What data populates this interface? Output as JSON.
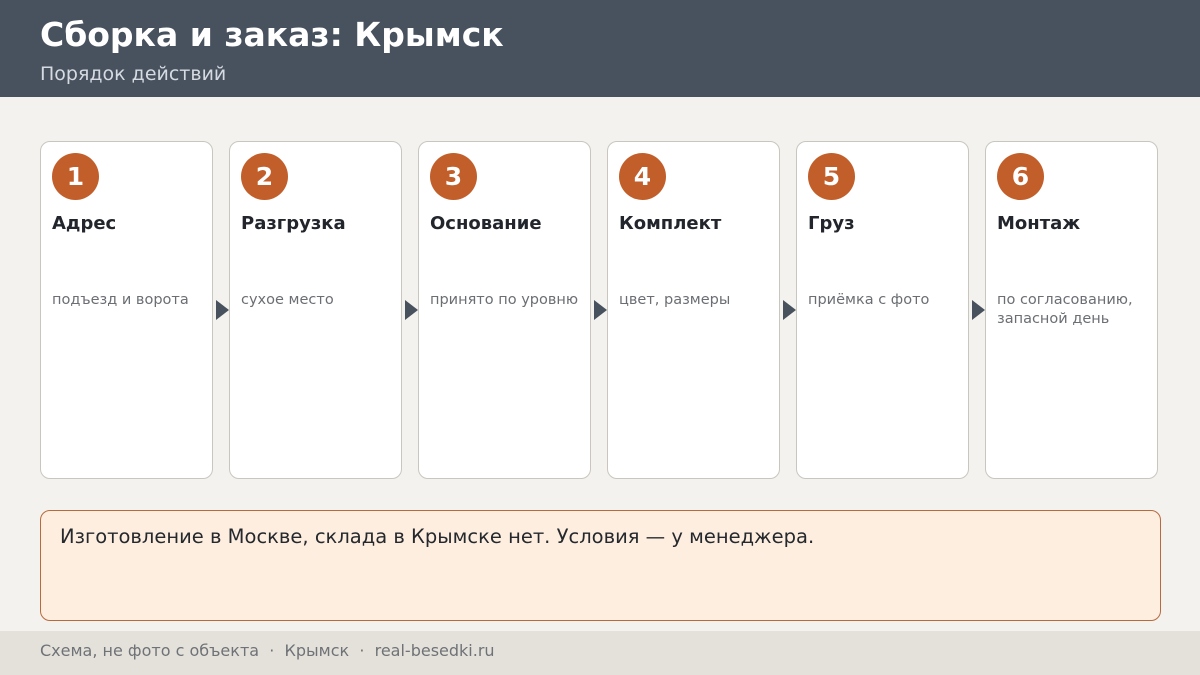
{
  "header": {
    "title": "Сборка и заказ: Крымск",
    "subtitle": "Порядок действий"
  },
  "steps": [
    {
      "number": "1",
      "title": "Адрес",
      "text": "подъезд и ворота"
    },
    {
      "number": "2",
      "title": "Разгрузка",
      "text": "сухое место"
    },
    {
      "number": "3",
      "title": "Основание",
      "text": "принято по уровню"
    },
    {
      "number": "4",
      "title": "Комплект",
      "text": "цвет, размеры"
    },
    {
      "number": "5",
      "title": "Груз",
      "text": "приёмка с фото"
    },
    {
      "number": "6",
      "title": "Монтаж",
      "text": "по согласованию, запасной день"
    }
  ],
  "note": {
    "text": "Изготовление в Москве, склада в Крымске нет. Условия — у менеджера."
  },
  "footer": {
    "text": "Схема, не фото с объекта  ·  Крымск  ·  real-besedki.ru"
  },
  "colors": {
    "header_bg": "#48515e",
    "accent": "#c25e2a",
    "note_bg": "#fdeee0",
    "page_bg": "#f4f2ee"
  }
}
